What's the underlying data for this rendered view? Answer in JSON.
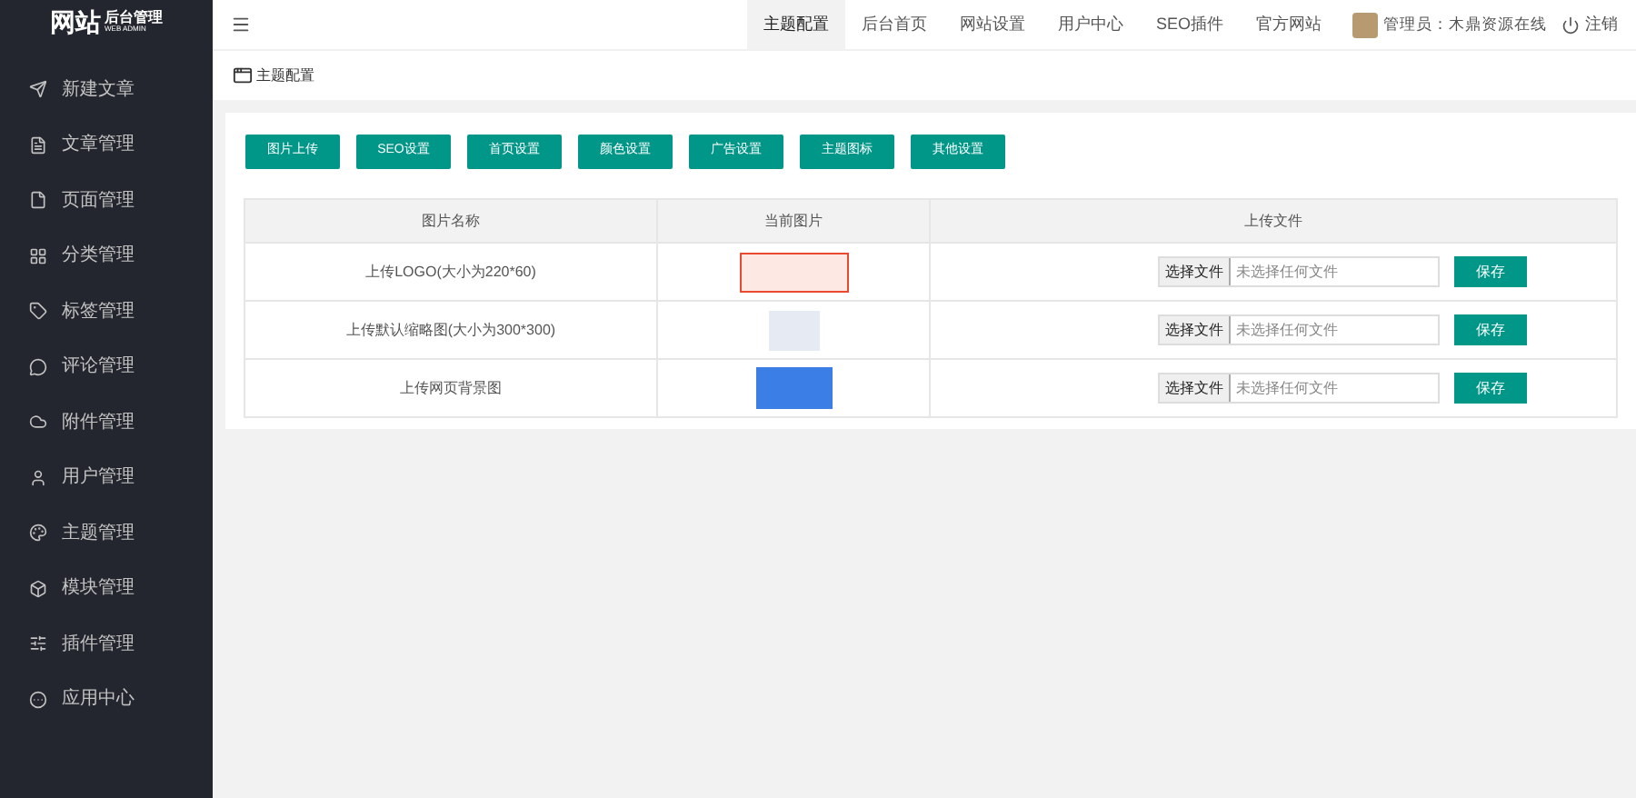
{
  "brand": {
    "title": "网站",
    "subtitle": "后台管理",
    "tagline": "WEB ADMIN"
  },
  "sidebar": {
    "items": [
      "新建文章",
      "文章管理",
      "页面管理",
      "分类管理",
      "标签管理",
      "评论管理",
      "附件管理",
      "用户管理",
      "主题管理",
      "模块管理",
      "插件管理",
      "应用中心"
    ]
  },
  "topnav": {
    "items": [
      {
        "label": "主题配置",
        "selected": true
      },
      {
        "label": "后台首页",
        "selected": false
      },
      {
        "label": "网站设置",
        "selected": false
      },
      {
        "label": "用户中心",
        "selected": false
      },
      {
        "label": "SEO插件",
        "selected": false
      },
      {
        "label": "官方网站",
        "selected": false
      }
    ],
    "admin": "管理员：木鼎资源在线",
    "logout": "注销"
  },
  "breadcrumb": "主题配置",
  "tab_buttons": [
    "图片上传",
    "SEO设置",
    "首页设置",
    "颜色设置",
    "广告设置",
    "主题图标",
    "其他设置"
  ],
  "table": {
    "columns": [
      "图片名称",
      "当前图片",
      "上传文件"
    ],
    "rows": [
      {
        "name": "上传LOGO(大小为220*60)",
        "kind": "logo",
        "file_button": "选择文件",
        "file_status": "未选择任何文件",
        "save": "保存"
      },
      {
        "name": "上传默认缩略图(大小为300*300)",
        "kind": "thumbnail",
        "file_button": "选择文件",
        "file_status": "未选择任何文件",
        "save": "保存"
      },
      {
        "name": "上传网页背景图",
        "kind": "solid",
        "file_button": "选择文件",
        "file_status": "未选择任何文件",
        "save": "保存"
      }
    ]
  }
}
